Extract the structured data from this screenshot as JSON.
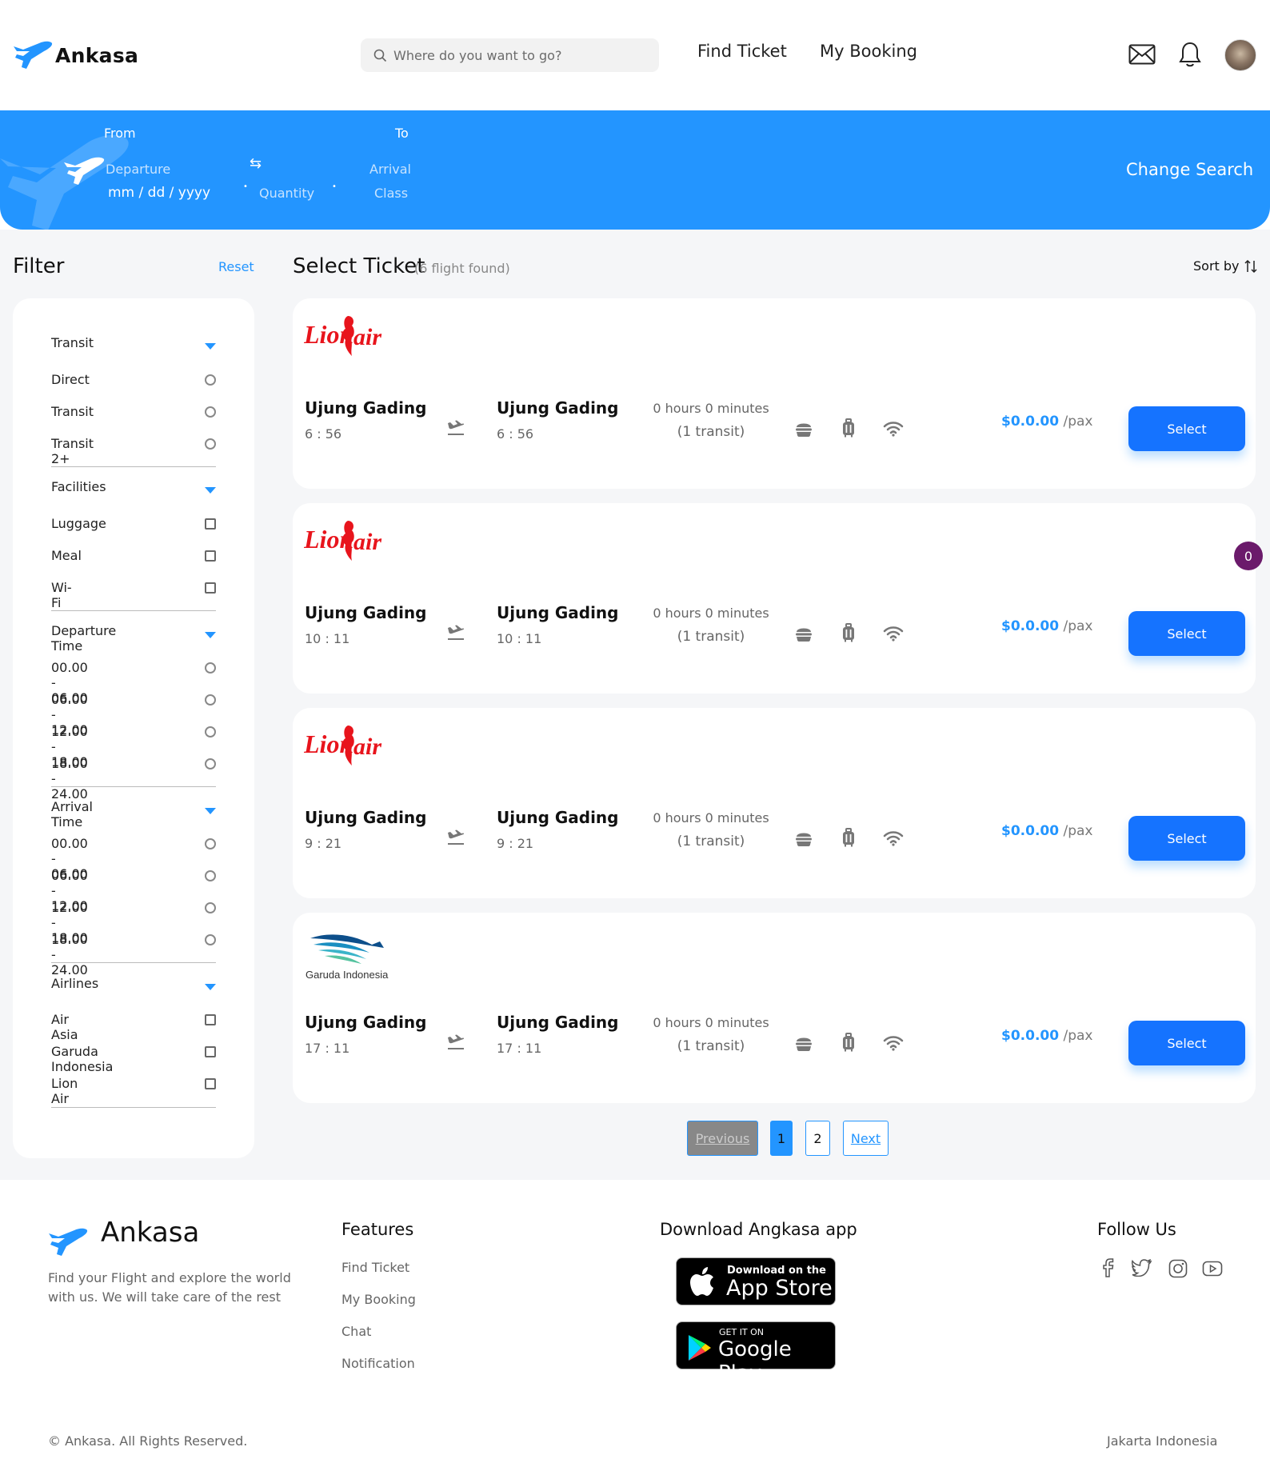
{
  "header": {
    "brand": "Ankasa",
    "search_placeholder": "Where do you want to go?",
    "nav": [
      "Find Ticket",
      "My Booking"
    ]
  },
  "banner": {
    "from_label": "From",
    "to_label": "To",
    "departure_placeholder": "Departure",
    "date_placeholder": "mm / dd / yyyy",
    "swap_icon": "⇆",
    "quantity_placeholder": "Quantity",
    "arrival_placeholder": "Arrival",
    "class_placeholder": "Class",
    "change_search": "Change Search"
  },
  "filter": {
    "title": "Filter",
    "reset": "Reset",
    "transit": {
      "title": "Transit",
      "options": [
        "Direct",
        "Transit",
        "Transit 2+"
      ]
    },
    "facilities": {
      "title": "Facilities",
      "options": [
        "Luggage",
        "Meal",
        "Wi-Fi"
      ]
    },
    "departure_time": {
      "title": "Departure Time",
      "options": [
        "00.00 - 06.00",
        "06.00 - 12.00",
        "12.00 - 18.00",
        "18.00 - 24.00"
      ]
    },
    "arrival_time": {
      "title": "Arrival Time",
      "options": [
        "00.00 - 06.00",
        "06.00 - 12.00",
        "12.00 - 18.00",
        "18.00 - 24.00"
      ]
    },
    "airlines": {
      "title": "Airlines",
      "options": [
        "Air Asia",
        "Garuda Indonesia",
        "Lion Air"
      ]
    }
  },
  "results": {
    "title": "Select Ticket",
    "count": "(6 flight found)",
    "sort": "Sort by",
    "notification_count": "0",
    "tickets": [
      {
        "airline_logo": "Lion air",
        "from": "Ujung Gading",
        "dep_time": "6 : 56",
        "to": "Ujung Gading",
        "arr_time": "6 : 56",
        "duration": "0 hours 0 minutes",
        "transit": "(1 transit)",
        "price": "$0.0.00",
        "pax": " /pax",
        "button": "Select"
      },
      {
        "airline_logo": "Lion air",
        "from": "Ujung Gading",
        "dep_time": "10 : 11",
        "to": "Ujung Gading",
        "arr_time": "10 : 11",
        "duration": "0 hours 0 minutes",
        "transit": "(1 transit)",
        "price": "$0.0.00",
        "pax": " /pax",
        "button": "Select"
      },
      {
        "airline_logo": "Lion air",
        "from": "Ujung Gading",
        "dep_time": "9 : 21",
        "to": "Ujung Gading",
        "arr_time": "9 : 21",
        "duration": "0 hours 0 minutes",
        "transit": "(1 transit)",
        "price": "$0.0.00",
        "pax": " /pax",
        "button": "Select"
      },
      {
        "airline_logo": "Garuda Indonesia",
        "from": "Ujung Gading",
        "dep_time": "17 : 11",
        "to": "Ujung Gading",
        "arr_time": "17 : 11",
        "duration": "0 hours 0 minutes",
        "transit": "(1 transit)",
        "price": "$0.0.00",
        "pax": " /pax",
        "button": "Select"
      }
    ]
  },
  "pagination": {
    "previous": "Previous",
    "pages": [
      "1",
      "2"
    ],
    "next": "Next"
  },
  "footer": {
    "brand": "Ankasa",
    "tagline_1": "Find your Flight and explore the world",
    "tagline_2": "with us. We will take care of the rest",
    "features_title": "Features",
    "features": [
      "Find Ticket",
      "My Booking",
      "Chat",
      "Notification"
    ],
    "download_title": "Download Angkasa app",
    "appstore_small": "Download on the",
    "appstore_big": "App Store",
    "googleplay_small": "GET IT ON",
    "googleplay_big": "Google Play",
    "follow_title": "Follow Us",
    "copyright": "© Ankasa. All Rights Reserved.",
    "location": "Jakarta Indonesia"
  }
}
